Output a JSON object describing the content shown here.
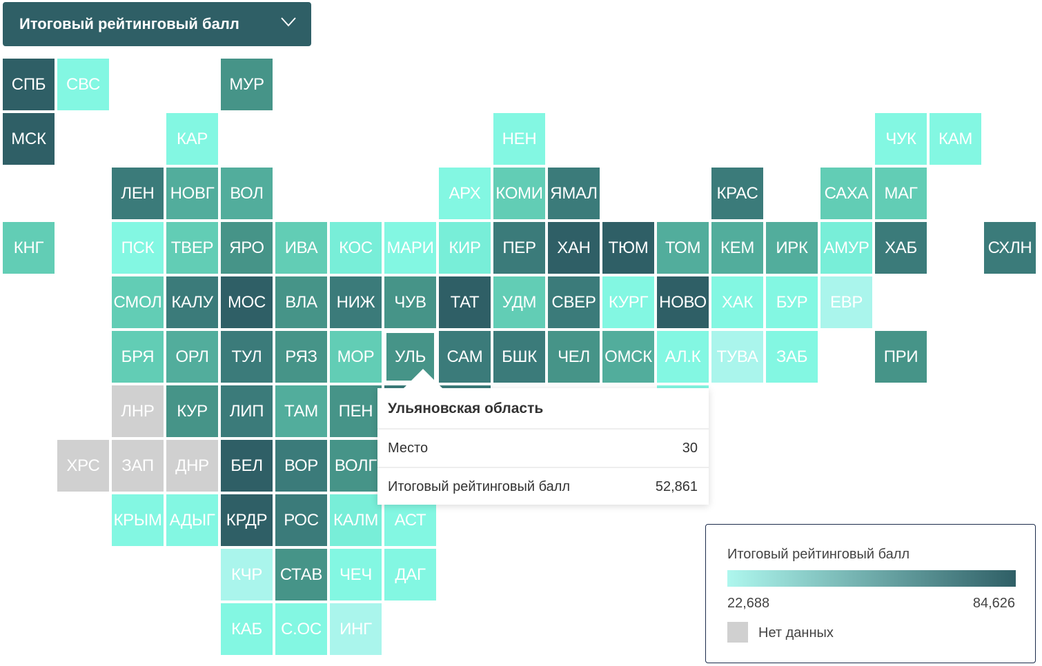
{
  "dropdown": {
    "label": "Итоговый рейтинговый балл",
    "icon": "chevron-down-icon"
  },
  "palette": [
    "#2f5f66",
    "#3b7b7a",
    "#469488",
    "#52ad9c",
    "#62cdb5",
    "#78eed8",
    "#83f7e2",
    "#aaf5ec"
  ],
  "no_data_color": "#d0d0d0",
  "tiles": [
    {
      "label": "СПБ",
      "level": 0
    },
    {
      "label": "СВС",
      "level": 6
    },
    {
      "label": "МУР",
      "level": 2
    },
    {
      "label": "МСК",
      "level": 0
    },
    {
      "label": "КАР",
      "level": 6
    },
    {
      "label": "НЕН",
      "level": 6
    },
    {
      "label": "ЧУК",
      "level": 6
    },
    {
      "label": "КАМ",
      "level": 6
    },
    {
      "label": "ЛЕН",
      "level": 1
    },
    {
      "label": "НОВГ",
      "level": 3
    },
    {
      "label": "ВОЛ",
      "level": 3
    },
    {
      "label": "АРХ",
      "level": 6
    },
    {
      "label": "КОМИ",
      "level": 4
    },
    {
      "label": "ЯМАЛ",
      "level": 1
    },
    {
      "label": "КРАС",
      "level": 1
    },
    {
      "label": "САХА",
      "level": 4
    },
    {
      "label": "МАГ",
      "level": 4
    },
    {
      "label": "КНГ",
      "level": 4
    },
    {
      "label": "ПСК",
      "level": 6
    },
    {
      "label": "ТВЕР",
      "level": 4
    },
    {
      "label": "ЯРО",
      "level": 2
    },
    {
      "label": "ИВА",
      "level": 4
    },
    {
      "label": "КОС",
      "level": 5
    },
    {
      "label": "МАРИ",
      "level": 6
    },
    {
      "label": "КИР",
      "level": 5
    },
    {
      "label": "ПЕР",
      "level": 1
    },
    {
      "label": "ХАН",
      "level": 0
    },
    {
      "label": "ТЮМ",
      "level": 0
    },
    {
      "label": "ТОМ",
      "level": 3
    },
    {
      "label": "КЕМ",
      "level": 3
    },
    {
      "label": "ИРК",
      "level": 3
    },
    {
      "label": "АМУР",
      "level": 5
    },
    {
      "label": "ХАБ",
      "level": 1
    },
    {
      "label": "СХЛН",
      "level": 1
    },
    {
      "label": "СМОЛ",
      "level": 4
    },
    {
      "label": "КАЛУ",
      "level": 1
    },
    {
      "label": "МОС",
      "level": 0
    },
    {
      "label": "ВЛА",
      "level": 2
    },
    {
      "label": "НИЖ",
      "level": 1
    },
    {
      "label": "ЧУВ",
      "level": 2
    },
    {
      "label": "ТАТ",
      "level": 0
    },
    {
      "label": "УДМ",
      "level": 4
    },
    {
      "label": "СВЕР",
      "level": 1
    },
    {
      "label": "КУРГ",
      "level": 6
    },
    {
      "label": "НОВО",
      "level": 0
    },
    {
      "label": "ХАК",
      "level": 6
    },
    {
      "label": "БУР",
      "level": 6
    },
    {
      "label": "ЕВР",
      "level": 7
    },
    {
      "label": "БРЯ",
      "level": 4
    },
    {
      "label": "ОРЛ",
      "level": 3
    },
    {
      "label": "ТУЛ",
      "level": 1
    },
    {
      "label": "РЯЗ",
      "level": 2
    },
    {
      "label": "МОР",
      "level": 4
    },
    {
      "label": "УЛЬ",
      "level": 2,
      "selected": true
    },
    {
      "label": "САМ",
      "level": 1
    },
    {
      "label": "БШК",
      "level": 1
    },
    {
      "label": "ЧЕЛ",
      "level": 2
    },
    {
      "label": "ОМСК",
      "level": 3
    },
    {
      "label": "АЛ.К",
      "level": 6
    },
    {
      "label": "ТУВА",
      "level": 7
    },
    {
      "label": "ЗАБ",
      "level": 6
    },
    {
      "label": "ПРИ",
      "level": 2
    },
    {
      "label": "ЛНР",
      "level": null
    },
    {
      "label": "КУР",
      "level": 2
    },
    {
      "label": "ЛИП",
      "level": 1
    },
    {
      "label": "ТАМ",
      "level": 3
    },
    {
      "label": "ПЕН",
      "level": 2
    },
    {
      "label": "ХРС",
      "level": null
    },
    {
      "label": "ЗАП",
      "level": null
    },
    {
      "label": "ДНР",
      "level": null
    },
    {
      "label": "БЕЛ",
      "level": 0
    },
    {
      "label": "ВОР",
      "level": 1
    },
    {
      "label": "ВОЛГ",
      "level": 2
    },
    {
      "label": "КРЫМ",
      "level": 6
    },
    {
      "label": "АДЫГ",
      "level": 6
    },
    {
      "label": "КРДР",
      "level": 0
    },
    {
      "label": "РОС",
      "level": 1
    },
    {
      "label": "КАЛМ",
      "level": 5
    },
    {
      "label": "АСТ",
      "level": 6
    },
    {
      "label": "КЧР",
      "level": 7
    },
    {
      "label": "СТАВ",
      "level": 2
    },
    {
      "label": "ЧЕЧ",
      "level": 6
    },
    {
      "label": "ДАГ",
      "level": 6
    },
    {
      "label": "КАБ",
      "level": 6
    },
    {
      "label": "С.ОС",
      "level": 6
    },
    {
      "label": "ИНГ",
      "level": 7
    }
  ],
  "tooltip": {
    "title": "Ульяновская область",
    "rows": [
      {
        "label": "Место",
        "value": "30"
      },
      {
        "label": "Итоговый рейтинговый балл",
        "value": "52,861"
      }
    ]
  },
  "legend": {
    "title": "Итоговый рейтинговый балл",
    "min": "22,688",
    "max": "84,626",
    "gradient": [
      "#aef7ee",
      "#2f5f66"
    ],
    "no_data_label": "Нет данных"
  }
}
